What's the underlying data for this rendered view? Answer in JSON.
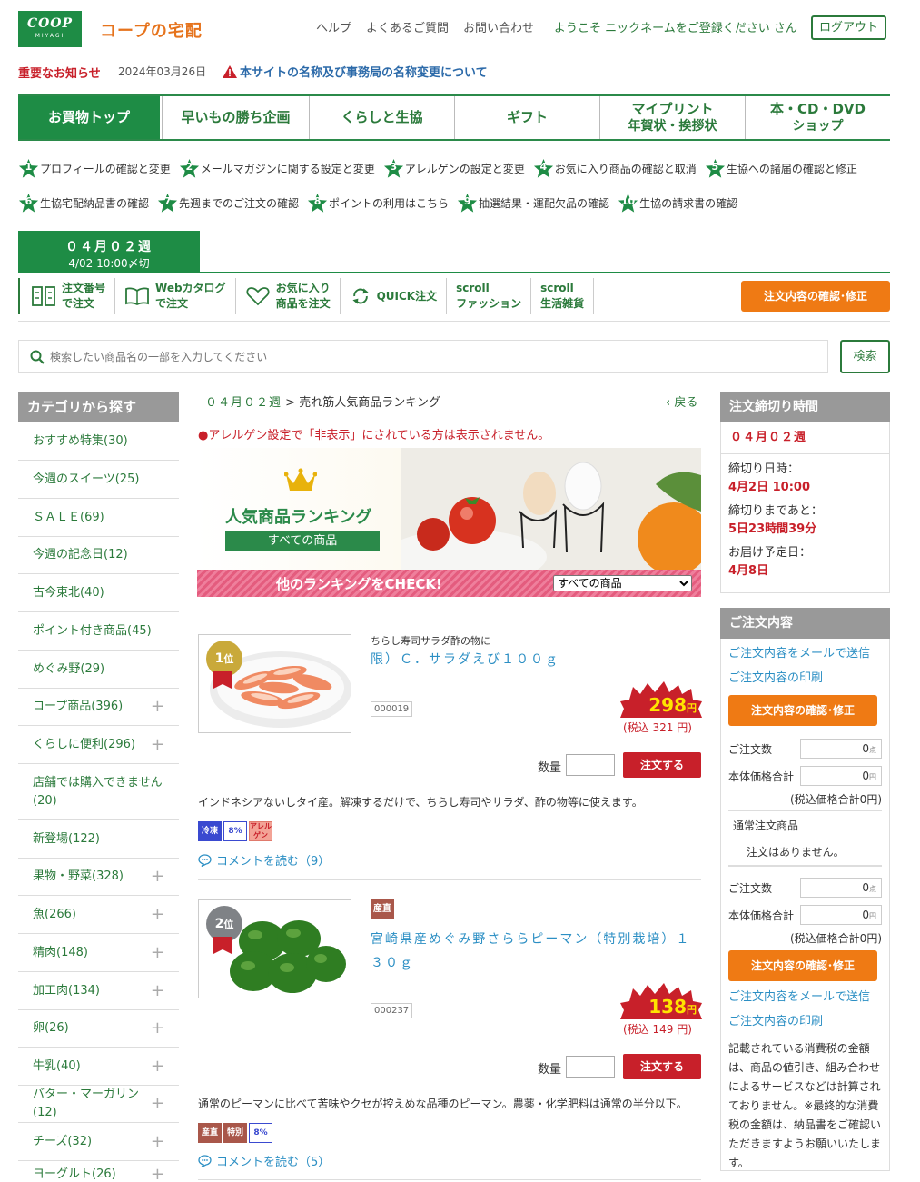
{
  "header": {
    "logo_main": "COOP",
    "logo_sub": "MIYAGI",
    "site_name": "コープの宅配",
    "links": [
      "ヘルプ",
      "よくあるご質問",
      "お問い合わせ"
    ],
    "welcome": "ようこそ ニックネームをご登録ください さん",
    "logout": "ログアウト"
  },
  "notice": {
    "label": "重要なお知らせ",
    "date": "2024年03月26日",
    "link": "本サイトの名称及び事務局の名称変更について"
  },
  "main_nav": [
    {
      "l1": "お買物トップ",
      "l2": ""
    },
    {
      "l1": "早いもの勝ち企画",
      "l2": ""
    },
    {
      "l1": "くらしと生協",
      "l2": ""
    },
    {
      "l1": "ギフト",
      "l2": ""
    },
    {
      "l1": "マイプリント",
      "l2": "年賀状・挨拶状"
    },
    {
      "l1": "本・CD・DVD",
      "l2": "ショップ"
    }
  ],
  "numbered_links_row1": [
    {
      "n": "1",
      "label": "プロフィールの確認と変更"
    },
    {
      "n": "2",
      "label": "メールマガジンに関する設定と変更"
    },
    {
      "n": "3",
      "label": "アレルゲンの設定と変更"
    },
    {
      "n": "4",
      "label": "お気に入り商品の確認と取消"
    },
    {
      "n": "5",
      "label": "生協への諸届の確認と修正"
    }
  ],
  "numbered_links_row2": [
    {
      "n": "6",
      "label": "生協宅配納品書の確認"
    },
    {
      "n": "7",
      "label": "先週までのご注文の確認"
    },
    {
      "n": "8",
      "label": "ポイントの利用はこちら"
    },
    {
      "n": "9",
      "label": "抽選結果・運配欠品の確認"
    },
    {
      "n": "10",
      "label": "生協の請求書の確認"
    }
  ],
  "week_tab": {
    "week": "０４月０２週",
    "deadline": "4/02 10:00〆切"
  },
  "sub_nav": [
    {
      "l1": "注文番号",
      "l2": "で注文",
      "icon": "order-number-icon"
    },
    {
      "l1": "Webカタログ",
      "l2": "で注文",
      "icon": "book-icon"
    },
    {
      "l1": "お気に入り",
      "l2": "商品を注文",
      "icon": "heart-icon"
    },
    {
      "l1": "QUICK注文",
      "l2": "",
      "icon": "refresh-icon"
    },
    {
      "l1": "scroll",
      "l2": "ファッション",
      "icon": ""
    },
    {
      "l1": "scroll",
      "l2": "生活雑貨",
      "icon": ""
    }
  ],
  "order_confirm_label": "注文内容の確認･修正",
  "search": {
    "placeholder": "検索したい商品名の一部を入力してください",
    "button": "検索"
  },
  "categories": {
    "title": "カテゴリから探す",
    "items": [
      {
        "label": "おすすめ特集(30)",
        "plus": false
      },
      {
        "label": "今週のスイーツ(25)",
        "plus": false
      },
      {
        "label": "ＳＡＬＥ(69)",
        "plus": false
      },
      {
        "label": "今週の記念日(12)",
        "plus": false
      },
      {
        "label": "古今東北(40)",
        "plus": false
      },
      {
        "label": "ポイント付き商品(45)",
        "plus": false
      },
      {
        "label": "めぐみ野(29)",
        "plus": false
      },
      {
        "label": "コープ商品(396)",
        "plus": true
      },
      {
        "label": "くらしに便利(296)",
        "plus": true
      },
      {
        "label": "店舗では購入できません(20)",
        "plus": false
      },
      {
        "label": "新登場(122)",
        "plus": false
      },
      {
        "label": "果物・野菜(328)",
        "plus": true
      },
      {
        "label": "魚(266)",
        "plus": true
      },
      {
        "label": "精肉(148)",
        "plus": true
      },
      {
        "label": "加工肉(134)",
        "plus": true
      },
      {
        "label": "卵(26)",
        "plus": true
      },
      {
        "label": "牛乳(40)",
        "plus": true
      },
      {
        "label": "バター・マーガリン(12)",
        "plus": true
      },
      {
        "label": "チーズ(32)",
        "plus": true
      },
      {
        "label": "ヨーグルト(26)",
        "plus": true
      }
    ]
  },
  "breadcrumb": {
    "week": "０４月０２週",
    "sep": ">",
    "current": "売れ筋人気商品ランキング"
  },
  "back": "戻る",
  "allergy_notice": "●アレルゲン設定で「非表示」にされている方は表示されません。",
  "banner": {
    "title": "人気商品ランキング",
    "ribbon": "すべての商品",
    "check": "他のランキングをCHECK!",
    "select_value": "すべての商品"
  },
  "products": [
    {
      "rank": "1",
      "rank_suffix": "位",
      "badge": "",
      "subtitle": "ちらし寿司サラダ酢の物に",
      "name": "限）Ｃ．サラダえび１００ｇ",
      "code": "000019",
      "price": "298",
      "yen": "円",
      "tax": "(税込 321 円)",
      "qty_label": "数量",
      "order": "注文する",
      "desc": "インドネシアないしタイ産。解凍するだけで、ちらし寿司やサラダ、酢の物等に使えます。",
      "tags": [
        "冷凍",
        "8%",
        "アレルゲン"
      ],
      "comment": "コメントを読む（9）"
    },
    {
      "rank": "2",
      "rank_suffix": "位",
      "badge": "産直",
      "subtitle": "",
      "name": "宮崎県産めぐみ野さららピーマン（特別栽培）１３０ｇ",
      "code": "000237",
      "price": "138",
      "yen": "円",
      "tax": "(税込 149 円)",
      "qty_label": "数量",
      "order": "注文する",
      "desc": "通常のピーマンに比べて苦味やクセが控えめな品種のピーマン。農薬・化学肥料は通常の半分以下。",
      "tags": [
        "産直",
        "特別",
        "8%"
      ],
      "comment": "コメントを読む（5）"
    }
  ],
  "deadline_panel": {
    "title": "注文締切り時間",
    "week": "０４月０２週",
    "deadline_label": "締切り日時：",
    "deadline_value": "4月2日 10:00",
    "remaining_label": "締切りまであと：",
    "remaining_value": "5日23時間39分",
    "delivery_label": "お届け予定日：",
    "delivery_value": "4月8日"
  },
  "order_panel": {
    "title": "ご注文内容",
    "mail_link": "ご注文内容をメールで送信",
    "print_link": "ご注文内容の印刷",
    "confirm": "注文内容の確認･修正",
    "count_label": "ご注文数",
    "count_value": "0",
    "count_unit": "点",
    "total_label": "本体価格合計",
    "total_value": "0",
    "total_unit": "円",
    "tax_total": "(税込価格合計0円)",
    "normal_section": "通常注文商品",
    "no_orders": "注文はありません。",
    "note": "記載されている消費税の金額は、商品の値引き、組み合わせによるサービスなどは計算されておりません。※最終的な消費税の金額は、納品書をご確認いただきますようお願いいたします。"
  },
  "colors": {
    "green": "#1e8c45",
    "orange": "#ef7a14",
    "red": "#c8202a",
    "link_blue": "#2c8fc4"
  }
}
